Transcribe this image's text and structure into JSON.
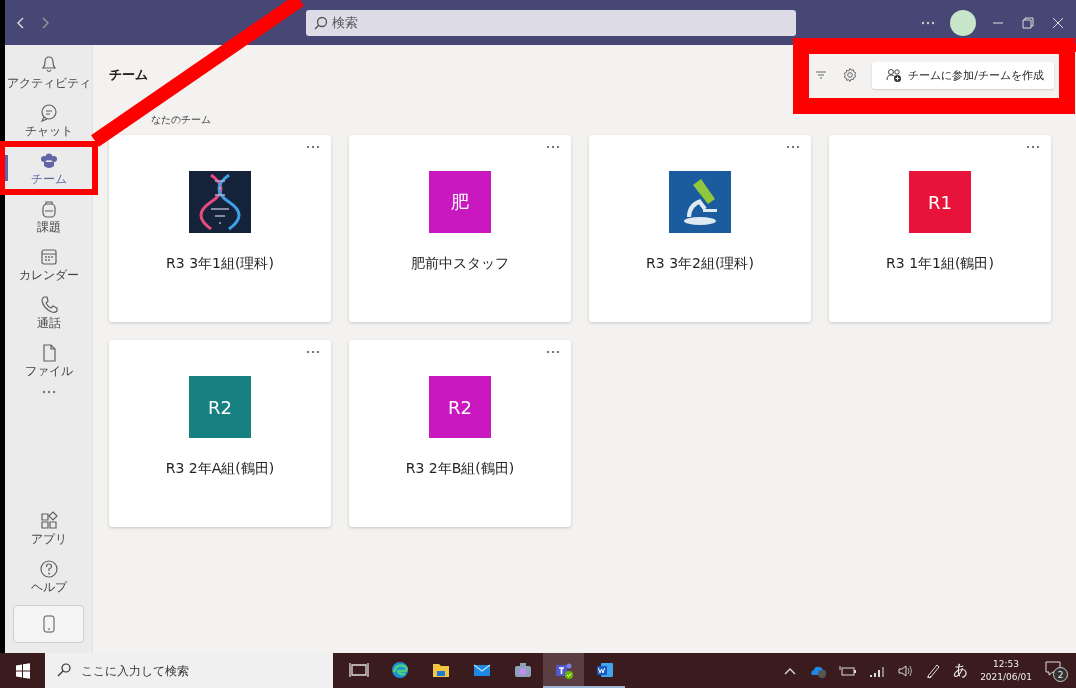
{
  "title_bar": {
    "search": {
      "placeholder": "検索"
    }
  },
  "rail": {
    "items": [
      {
        "label": "アクティビティ",
        "kind": "bell",
        "selected": false
      },
      {
        "label": "チャット",
        "kind": "chat",
        "selected": false
      },
      {
        "label": "チーム",
        "kind": "teams",
        "selected": true
      },
      {
        "label": "課題",
        "kind": "backpack",
        "selected": false
      },
      {
        "label": "カレンダー",
        "kind": "calendar",
        "selected": false
      },
      {
        "label": "通話",
        "kind": "phone",
        "selected": false
      },
      {
        "label": "ファイル",
        "kind": "file",
        "selected": false
      }
    ],
    "bottom_items": [
      {
        "label": "アプリ",
        "kind": "apps"
      },
      {
        "label": "ヘルプ",
        "kind": "help"
      }
    ]
  },
  "page": {
    "title": "チーム",
    "join_button": "チームに参加/チームを作成",
    "section_title": "なたのチーム"
  },
  "teams": [
    {
      "name": "R3 3年1組(理科)",
      "kind": "dna"
    },
    {
      "name": "肥前中スタッフ",
      "kind": "initials",
      "initials": "肥",
      "color": "#c918c0"
    },
    {
      "name": "R3 3年2組(理科)",
      "kind": "microscope"
    },
    {
      "name": "R3 1年1組(鶴田)",
      "kind": "initials",
      "initials": "R1",
      "color": "#e8133b"
    },
    {
      "name": "R3 2年A組(鶴田)",
      "kind": "initials",
      "initials": "R2",
      "color": "#178080"
    },
    {
      "name": "R3 2年B組(鶴田)",
      "kind": "initials",
      "initials": "R2",
      "color": "#c918c0"
    }
  ],
  "taskbar": {
    "search": {
      "placeholder": "ここに入力して検索"
    },
    "apps": [
      {
        "kind": "taskview",
        "selected": false,
        "running": false
      },
      {
        "kind": "browser",
        "selected": false,
        "running": false
      },
      {
        "kind": "folder",
        "selected": false,
        "running": false
      },
      {
        "kind": "mail",
        "selected": false,
        "running": false
      },
      {
        "kind": "camera",
        "selected": false,
        "running": false
      },
      {
        "kind": "teams",
        "selected": true,
        "running": true
      },
      {
        "kind": "word",
        "selected": false,
        "running": true
      }
    ],
    "ime": "あ",
    "time": "12:53",
    "date": "2021/06/01",
    "notifications": "2"
  }
}
